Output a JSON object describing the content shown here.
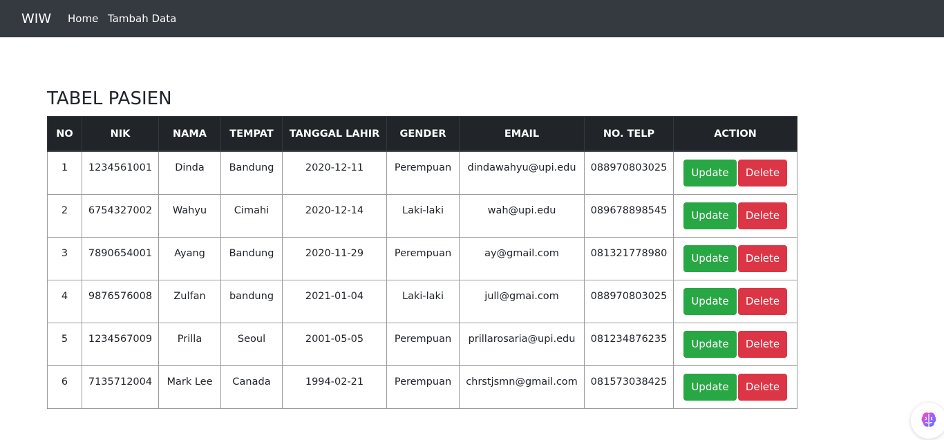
{
  "navbar": {
    "brand": "WIW",
    "links": [
      "Home",
      "Tambah Data"
    ]
  },
  "page": {
    "title": "TABEL PASIEN"
  },
  "table": {
    "headers": [
      "NO",
      "NIK",
      "NAMA",
      "TEMPAT",
      "TANGGAL LAHIR",
      "GENDER",
      "EMAIL",
      "NO. TELP",
      "ACTION"
    ],
    "rows": [
      {
        "no": "1",
        "nik": "1234561001",
        "nama": "Dinda",
        "tempat": "Bandung",
        "tanggal_lahir": "2020-12-11",
        "gender": "Perempuan",
        "email": "dindawahyu@upi.edu",
        "telp": "088970803025"
      },
      {
        "no": "2",
        "nik": "6754327002",
        "nama": "Wahyu",
        "tempat": "Cimahi",
        "tanggal_lahir": "2020-12-14",
        "gender": "Laki-laki",
        "email": "wah@upi.edu",
        "telp": "089678898545"
      },
      {
        "no": "3",
        "nik": "7890654001",
        "nama": "Ayang",
        "tempat": "Bandung",
        "tanggal_lahir": "2020-11-29",
        "gender": "Perempuan",
        "email": "ay@gmail.com",
        "telp": "081321778980"
      },
      {
        "no": "4",
        "nik": "9876576008",
        "nama": "Zulfan",
        "tempat": "bandung",
        "tanggal_lahir": "2021-01-04",
        "gender": "Laki-laki",
        "email": "jull@gmai.com",
        "telp": "088970803025"
      },
      {
        "no": "5",
        "nik": "1234567009",
        "nama": "Prilla",
        "tempat": "Seoul",
        "tanggal_lahir": "2001-05-05",
        "gender": "Perempuan",
        "email": "prillarosaria@upi.edu",
        "telp": "081234876235"
      },
      {
        "no": "6",
        "nik": "7135712004",
        "nama": "Mark Lee",
        "tempat": "Canada",
        "tanggal_lahir": "1994-02-21",
        "gender": "Perempuan",
        "email": "chrstjsmn@gmail.com",
        "telp": "081573038425"
      }
    ],
    "update_label": "Update",
    "delete_label": "Delete"
  },
  "colors": {
    "navbar_bg": "#343a40",
    "header_bg": "#212529",
    "update_btn": "#28a745",
    "delete_btn": "#dc3545"
  },
  "icons": {
    "floating_button": "brain-icon"
  }
}
